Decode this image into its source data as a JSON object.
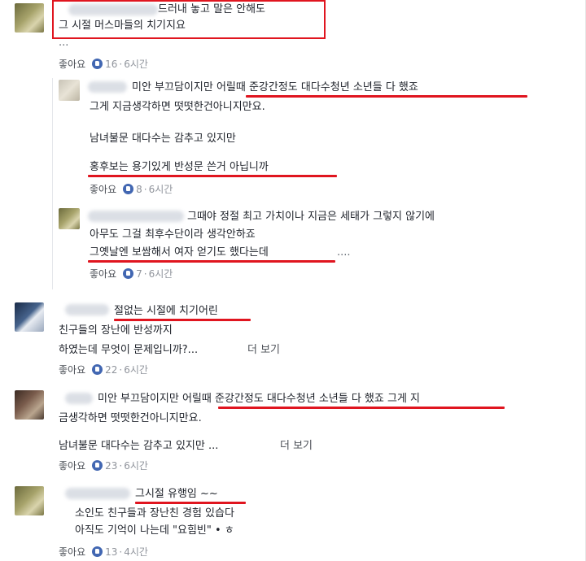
{
  "comments": [
    {
      "lines": [
        "드러내 놓고 말은 안해도",
        "그 시절 머스마들의 치기지요",
        "..."
      ],
      "like_label": "좋아요",
      "likes": "16",
      "time": "6시간"
    },
    {
      "lines": [
        "미안 부끄담이지만 어릴때 준강간정도 대다수청년 소년들 다 했죠",
        "그게 지금생각하면 떳떳한건아니지만요.",
        "남녀불문 대다수는 감추고 있지만",
        "홍후보는 용기있게 반성문 쓴거 아닙니까"
      ],
      "like_label": "좋아요",
      "likes": "8",
      "time": "6시간"
    },
    {
      "lines": [
        "그때야 정절 최고 가치이나 지금은 세태가 그렇지 않기에",
        "아무도 그걸 최후수단이라 생각안하죠",
        "그옛날엔 보쌈해서 여자 얻기도 했다는데",
        "...."
      ],
      "like_label": "좋아요",
      "likes": "7",
      "time": "6시간"
    },
    {
      "lines": [
        "절없는 시절에 치기어린",
        "친구들의 장난에 반성까지",
        "하였는데 무엇이 문제입니까?...",
        "더 보기"
      ],
      "like_label": "좋아요",
      "likes": "22",
      "time": "6시간"
    },
    {
      "lines": [
        "미안 부끄담이지만 어릴때 준강간정도 대다수청년 소년들 다 했죠 그게 지",
        "금생각하면 떳떳한건아니지만요.",
        "남녀불문 대다수는 감추고 있지만 ...",
        "더 보기"
      ],
      "like_label": "좋아요",
      "likes": "23",
      "time": "6시간"
    },
    {
      "lines": [
        "그시절 유행임 ~~",
        "소인도 친구들과 장난친 경험 있습다",
        "아직도 기억이 나는데 \"요힘빈\" • ㅎ"
      ],
      "like_label": "좋아요",
      "likes": "13",
      "time": "4시간"
    }
  ],
  "highlight_color": "#e0151f",
  "like_icon_color": "#4267b2",
  "like_icon": "thumbs-up-icon"
}
